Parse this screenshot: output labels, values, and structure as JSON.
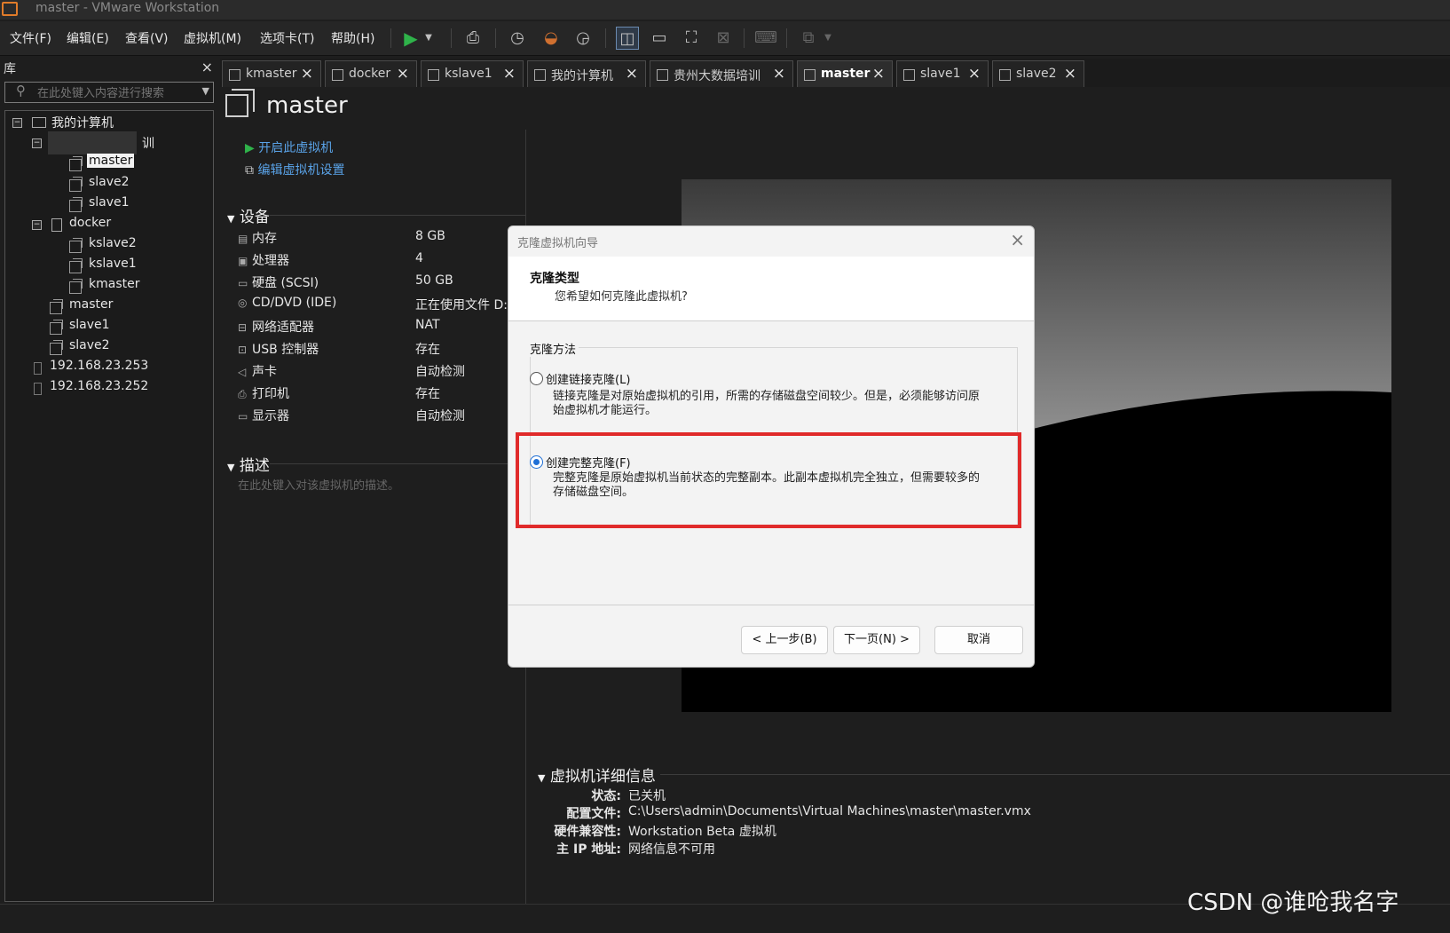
{
  "window": {
    "title": "master - VMware Workstation"
  },
  "menu": [
    "文件(F)",
    "编辑(E)",
    "查看(V)",
    "虚拟机(M)",
    "选项卡(T)",
    "帮助(H)"
  ],
  "library": {
    "title": "库",
    "close": "×",
    "search_placeholder": "在此处键入内容进行搜索",
    "tree": {
      "root": "我的计算机",
      "group1": "训",
      "group1_items": [
        "master",
        "slave2",
        "slave1"
      ],
      "group2": "docker",
      "group2_items": [
        "kslave2",
        "kslave1",
        "kmaster"
      ],
      "root_items": [
        "master",
        "slave1",
        "slave2"
      ],
      "hosts": [
        "192.168.23.253",
        "192.168.23.252"
      ]
    }
  },
  "tabs": [
    {
      "label": "kmaster",
      "active": false
    },
    {
      "label": "docker",
      "active": false
    },
    {
      "label": "kslave1",
      "active": false
    },
    {
      "label": "我的计算机",
      "active": false
    },
    {
      "label": "贵州大数据培训",
      "active": false
    },
    {
      "label": "master",
      "active": true
    },
    {
      "label": "slave1",
      "active": false
    },
    {
      "label": "slave2",
      "active": false
    }
  ],
  "tab_close": "×",
  "vm": {
    "name": "master",
    "actions": {
      "power_on": "开启此虚拟机",
      "edit_settings": "编辑虚拟机设置"
    },
    "devices_title": "设备",
    "devices": [
      {
        "icon": "memory-icon",
        "name": "内存",
        "value": "8 GB"
      },
      {
        "icon": "cpu-icon",
        "name": "处理器",
        "value": "4"
      },
      {
        "icon": "disk-icon",
        "name": "硬盘 (SCSI)",
        "value": "50 GB"
      },
      {
        "icon": "cd-icon",
        "name": "CD/DVD (IDE)",
        "value": "正在使用文件 D:\\"
      },
      {
        "icon": "network-icon",
        "name": "网络适配器",
        "value": "NAT"
      },
      {
        "icon": "usb-icon",
        "name": "USB 控制器",
        "value": "存在"
      },
      {
        "icon": "sound-icon",
        "name": "声卡",
        "value": "自动检测"
      },
      {
        "icon": "printer-icon",
        "name": "打印机",
        "value": "存在"
      },
      {
        "icon": "display-icon",
        "name": "显示器",
        "value": "自动检测"
      }
    ],
    "description_title": "描述",
    "description_placeholder": "在此处键入对该虚拟机的描述。",
    "details_title": "虚拟机详细信息",
    "details": [
      {
        "label": "状态:",
        "value": "已关机"
      },
      {
        "label": "配置文件:",
        "value": "C:\\Users\\admin\\Documents\\Virtual Machines\\master\\master.vmx"
      },
      {
        "label": "硬件兼容性:",
        "value": "Workstation Beta 虚拟机"
      },
      {
        "label": "主 IP 地址:",
        "value": "网络信息不可用"
      }
    ]
  },
  "dialog": {
    "title": "克隆虚拟机向导",
    "close": "×",
    "heading": "克隆类型",
    "subheading": "您希望如何克隆此虚拟机?",
    "group_title": "克隆方法",
    "options": [
      {
        "label": "创建链接克隆(L)",
        "desc": "链接克隆是对原始虚拟机的引用，所需的存储磁盘空间较少。但是，必须能够访问原始虚拟机才能运行。",
        "selected": false
      },
      {
        "label": "创建完整克隆(F)",
        "desc": "完整克隆是原始虚拟机当前状态的完整副本。此副本虚拟机完全独立，但需要较多的存储磁盘空间。",
        "selected": true
      }
    ],
    "buttons": {
      "back": "< 上一步(B)",
      "next": "下一页(N) >",
      "cancel": "取消"
    }
  },
  "colors": {
    "accent_link": "#5aa3e8",
    "highlight_box": "#e02a2a",
    "radio_selected": "#1f6fd6",
    "play_green": "#2fb34a"
  },
  "watermark": "CSDN @谁呛我名字"
}
